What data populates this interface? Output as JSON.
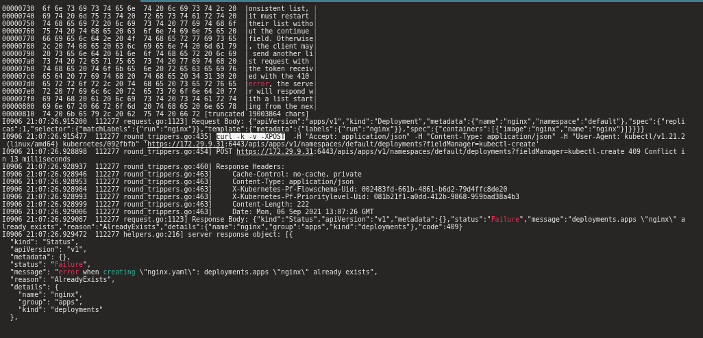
{
  "terminal": {
    "lines": [
      {
        "segments": [
          {
            "kind": "plain",
            "text": "00000730  6f 6e 73 69 73 74 65 6e  74 20 6c 69 73 74 2c 20  |onsistent list, "
          },
          {
            "kind": "border",
            "text": "|"
          }
        ]
      },
      {
        "segments": [
          {
            "kind": "plain",
            "text": "00000740  69 74 20 6d 75 73 74 20  72 65 73 74 61 72 74 20  |it must restart "
          },
          {
            "kind": "border",
            "text": "|"
          }
        ]
      },
      {
        "segments": [
          {
            "kind": "plain",
            "text": "00000750  74 68 65 69 72 20 6c 69  73 74 20 77 69 74 68 6f  |their list witho"
          },
          {
            "kind": "border",
            "text": "|"
          }
        ]
      },
      {
        "segments": [
          {
            "kind": "plain",
            "text": "00000760  75 74 20 74 68 65 20 63  6f 6e 74 69 6e 75 65 20  |ut the continue "
          },
          {
            "kind": "border",
            "text": "|"
          }
        ]
      },
      {
        "segments": [
          {
            "kind": "plain",
            "text": "00000770  66 69 65 6c 64 2e 20 4f  74 68 65 72 77 69 73 65  |field. Otherwise"
          },
          {
            "kind": "border",
            "text": "|"
          }
        ]
      },
      {
        "segments": [
          {
            "kind": "plain",
            "text": "00000780  2c 20 74 68 65 20 63 6c  69 65 6e 74 20 6d 61 79  |, the client may"
          },
          {
            "kind": "border",
            "text": "|"
          }
        ]
      },
      {
        "segments": [
          {
            "kind": "plain",
            "text": "00000790  20 73 65 6e 64 20 61 6e  6f 74 68 65 72 20 6c 69  | send another li"
          },
          {
            "kind": "border",
            "text": "|"
          }
        ]
      },
      {
        "segments": [
          {
            "kind": "plain",
            "text": "000007a0  73 74 20 72 65 71 75 65  73 74 20 77 69 74 68 20  |st request with "
          },
          {
            "kind": "border",
            "text": "|"
          }
        ]
      },
      {
        "segments": [
          {
            "kind": "plain",
            "text": "000007b0  74 68 65 20 74 6f 6b 65  6e 20 72 65 63 65 69 76  |the token receiv"
          },
          {
            "kind": "border",
            "text": "|"
          }
        ]
      },
      {
        "segments": [
          {
            "kind": "plain",
            "text": "000007c0  65 64 20 77 69 74 68 20  74 68 65 20 34 31 30 20  |ed with the 410 "
          },
          {
            "kind": "border",
            "text": "|"
          }
        ]
      },
      {
        "segments": [
          {
            "kind": "plain",
            "text": "000007d0  65 72 72 6f 72 2c 20 74  68 65 20 73 65 72 76 65  |"
          },
          {
            "kind": "error",
            "text": "error"
          },
          {
            "kind": "plain",
            "text": ", the serve"
          },
          {
            "kind": "border",
            "text": "|"
          }
        ]
      },
      {
        "segments": [
          {
            "kind": "plain",
            "text": "000007e0  72 20 77 69 6c 6c 20 72  65 73 70 6f 6e 64 20 77  |r will respond w"
          },
          {
            "kind": "border",
            "text": "|"
          }
        ]
      },
      {
        "segments": [
          {
            "kind": "plain",
            "text": "000007f0  69 74 68 20 61 20 6c 69  73 74 20 73 74 61 72 74  |ith a list start"
          },
          {
            "kind": "border",
            "text": "|"
          }
        ]
      },
      {
        "segments": [
          {
            "kind": "plain",
            "text": "00000800  69 6e 67 20 66 72 6f 6d  20 74 68 65 20 6e 65 78  |ing from the nex"
          },
          {
            "kind": "border",
            "text": "|"
          }
        ]
      },
      {
        "segments": [
          {
            "kind": "plain",
            "text": "00000810  74 20 6b 65 79 2c 20 62  75 74 20 66 72 [truncated 19003864 chars]"
          }
        ]
      },
      {
        "segments": [
          {
            "kind": "plain",
            "text": "I0906 21:07:26.915200  112277 request.go:1123] Request Body: {\"apiVersion\":\"apps/v1\",\"kind\":\"Deployment\",\"metadata\":{\"name\":\"nginx\",\"namespace\":\"default\"},\"spec\":{\"repli"
          }
        ]
      },
      {
        "segments": [
          {
            "kind": "plain",
            "text": "cas\":1,\"selector\":{\"matchLabels\":{\"run\":\"nginx\"}},\"template\":{\"metadata\":{\"labels\":{\"run\":\"nginx\"}},\"spec\":{\"containers\":[{\"image\":\"nginx\",\"name\":\"nginx\"}]}}}}"
          }
        ]
      },
      {
        "segments": [
          {
            "kind": "plain",
            "text": "I0906 21:07:26.915477  112277 round_trippers.go:435] "
          },
          {
            "kind": "selected",
            "text": "curl -k -v -XPOST"
          },
          {
            "kind": "plain",
            "text": "  -H \"Accept: application/json\" -H \"Content-Type: application/json\" -H \"User-Agent: kubectl/v1.21.2"
          }
        ]
      },
      {
        "segments": [
          {
            "kind": "plain",
            "text": " (linux/amd64) kubernetes/092fbfb\" '"
          },
          {
            "kind": "link",
            "text": "https://172.29.9.31"
          },
          {
            "kind": "plain",
            "text": ":6443/apis/apps/v1/namespaces/default/deployments?fieldManager=kubectl-create'"
          }
        ]
      },
      {
        "segments": [
          {
            "kind": "plain",
            "text": "I0906 21:07:26.928898  112277 round_trippers.go:454] POST "
          },
          {
            "kind": "link",
            "text": "https://172.29.9.31"
          },
          {
            "kind": "plain",
            "text": ":6443/apis/apps/v1/namespaces/default/deployments?fieldManager=kubectl-create 409 Conflict i"
          }
        ]
      },
      {
        "segments": [
          {
            "kind": "plain",
            "text": "n 13 milliseconds"
          }
        ]
      },
      {
        "segments": [
          {
            "kind": "plain",
            "text": "I0906 21:07:26.928937  112277 round_trippers.go:460] Response Headers:"
          }
        ]
      },
      {
        "segments": [
          {
            "kind": "plain",
            "text": "I0906 21:07:26.928946  112277 round_trippers.go:463]     Cache-Control: no-cache, private"
          }
        ]
      },
      {
        "segments": [
          {
            "kind": "plain",
            "text": "I0906 21:07:26.928953  112277 round_trippers.go:463]     Content-Type: application/json"
          }
        ]
      },
      {
        "segments": [
          {
            "kind": "plain",
            "text": "I0906 21:07:26.928984  112277 round_trippers.go:463]     X-Kubernetes-Pf-Flowschema-Uid: 002483fd-661b-4861-b6d2-79d4ffc8de20"
          }
        ]
      },
      {
        "segments": [
          {
            "kind": "plain",
            "text": "I0906 21:07:26.928993  112277 round_trippers.go:463]     X-Kubernetes-Pf-Prioritylevel-Uid: 081b21f1-a0dd-412b-9868-959bad38a4b3"
          }
        ]
      },
      {
        "segments": [
          {
            "kind": "plain",
            "text": "I0906 21:07:26.928999  112277 round_trippers.go:463]     Content-Length: 222"
          }
        ]
      },
      {
        "segments": [
          {
            "kind": "plain",
            "text": "I0906 21:07:26.929006  112277 round_trippers.go:463]     Date: Mon, 06 Sep 2021 13:07:26 GMT"
          }
        ]
      },
      {
        "segments": [
          {
            "kind": "plain",
            "text": "I0906 21:07:26.929087  112277 request.go:1123] Response Body: {\"kind\":\"Status\",\"apiVersion\":\"v1\",\"metadata\":{},\"status\":\""
          },
          {
            "kind": "error",
            "text": "Failure"
          },
          {
            "kind": "plain",
            "text": "\",\"message\":\"deployments.apps \\\"nginx\\\" a"
          }
        ]
      },
      {
        "segments": [
          {
            "kind": "plain",
            "text": "lready exists\",\"reason\":\"AlreadyExists\",\"details\":{\"name\":\"nginx\",\"group\":\"apps\",\"kind\":\"deployments\"},\"code\":409}"
          }
        ]
      },
      {
        "segments": [
          {
            "kind": "plain",
            "text": "I0906 21:07:26.929472  112277 helpers.go:216] server response object: [{"
          }
        ]
      },
      {
        "segments": [
          {
            "kind": "plain",
            "text": "  \"kind\": \"Status\","
          }
        ]
      },
      {
        "segments": [
          {
            "kind": "plain",
            "text": "  \"apiVersion\": \"v1\","
          }
        ]
      },
      {
        "segments": [
          {
            "kind": "plain",
            "text": "  \"metadata\": {},"
          }
        ]
      },
      {
        "segments": [
          {
            "kind": "plain",
            "text": "  \"status\": \""
          },
          {
            "kind": "error",
            "text": "Failure"
          },
          {
            "kind": "plain",
            "text": "\","
          }
        ]
      },
      {
        "segments": [
          {
            "kind": "plain",
            "text": "  \"message\": \""
          },
          {
            "kind": "error",
            "text": "error"
          },
          {
            "kind": "plain",
            "text": " when "
          },
          {
            "kind": "keyword",
            "text": "creating"
          },
          {
            "kind": "plain",
            "text": " \\\"nginx.yaml\\\": deployments.apps \\\"nginx\\\" already exists\","
          }
        ]
      },
      {
        "segments": [
          {
            "kind": "plain",
            "text": "  \"reason\": \"AlreadyExists\","
          }
        ]
      },
      {
        "segments": [
          {
            "kind": "plain",
            "text": "  \"details\": {"
          }
        ]
      },
      {
        "segments": [
          {
            "kind": "plain",
            "text": "    \"name\": \"nginx\","
          }
        ]
      },
      {
        "segments": [
          {
            "kind": "plain",
            "text": "    \"group\": \"apps\","
          }
        ]
      },
      {
        "segments": [
          {
            "kind": "plain",
            "text": "    \"kind\": \"deployments\""
          }
        ]
      },
      {
        "segments": [
          {
            "kind": "plain",
            "text": "  },"
          }
        ]
      }
    ]
  }
}
